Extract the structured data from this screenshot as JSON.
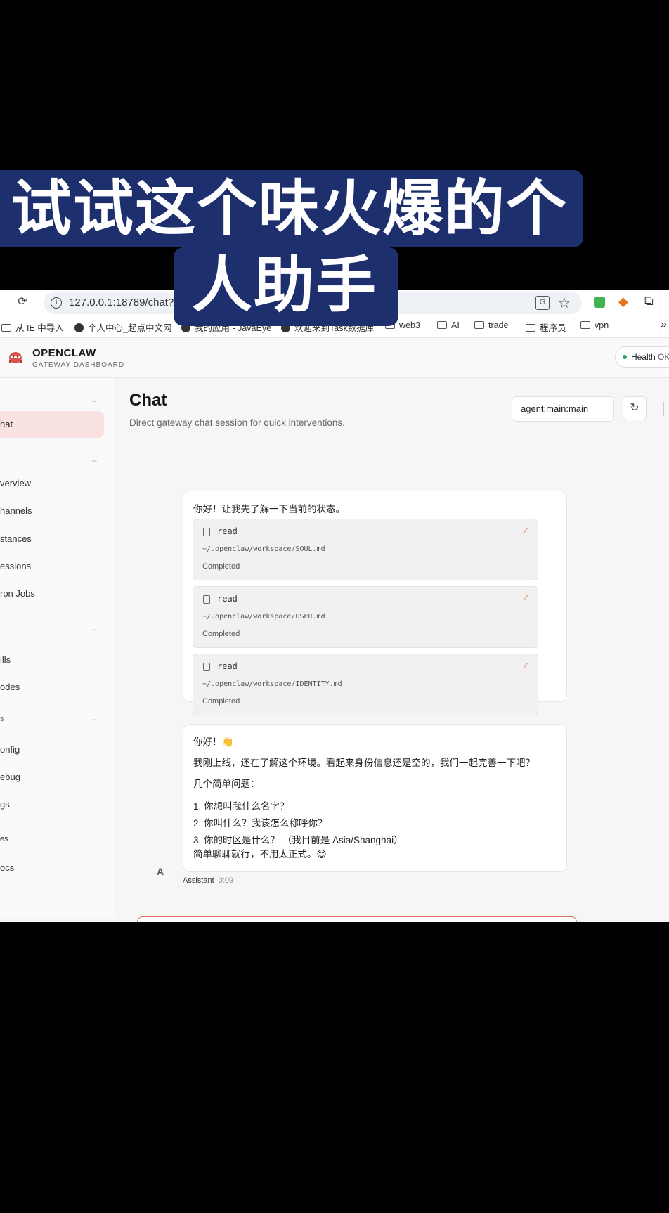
{
  "caption": {
    "line1": "试试这个味火爆的个",
    "line2": "人助手"
  },
  "browser": {
    "url": "127.0.0.1:18789/chat?session=agent%3Amain%3Amain",
    "bookmarks": [
      "从 IE 中导入",
      "个人中心_起点中文网",
      "我的应用 - JavaEye",
      "欢迎来到Task数据库",
      "web3",
      "AI",
      "trade",
      "程序员",
      "vpn"
    ],
    "more_label": "»"
  },
  "app": {
    "brand": "OPENCLAW",
    "brand_sub": "GATEWAY DASHBOARD",
    "health_label": "Health",
    "health_status": "OK",
    "accent_color": "#e06a5a"
  },
  "sidebar": {
    "items": [
      "hat",
      "verview",
      "hannels",
      "stances",
      "essions",
      "ron Jobs",
      "ills",
      "odes",
      "onfig",
      "ebug",
      "gs",
      "es",
      "ocs"
    ],
    "group_labels": [
      "s"
    ]
  },
  "main": {
    "title": "Chat",
    "subtitle": "Direct gateway chat session for quick interventions.",
    "session_value": "agent:main:main"
  },
  "messages": {
    "m1_intro": "你好！让我先了解一下当前的状态。",
    "tools": [
      {
        "name": "read",
        "path": "~/.openclaw/workspace/SOUL.md",
        "status": "Completed"
      },
      {
        "name": "read",
        "path": "~/.openclaw/workspace/USER.md",
        "status": "Completed"
      },
      {
        "name": "read",
        "path": "~/.openclaw/workspace/IDENTITY.md",
        "status": "Completed"
      }
    ],
    "m2_greeting": "你好！👋",
    "m2_line1": "我刚上线，还在了解这个环境。看起来身份信息还是空的，我们一起完善一下吧？",
    "m2_line2": "几个简单问题：",
    "m2_q1": "1. 你想叫我什么名字？",
    "m2_q2": "2. 你叫什么？我该怎么称呼你？",
    "m2_q3": "3. 你的时区是什么？ （我目前是 Asia/Shanghai）",
    "m2_line3": "简单聊聊就行，不用太正式。😊",
    "avatar_letter": "A",
    "sender": "Assistant",
    "time": "0:09"
  }
}
